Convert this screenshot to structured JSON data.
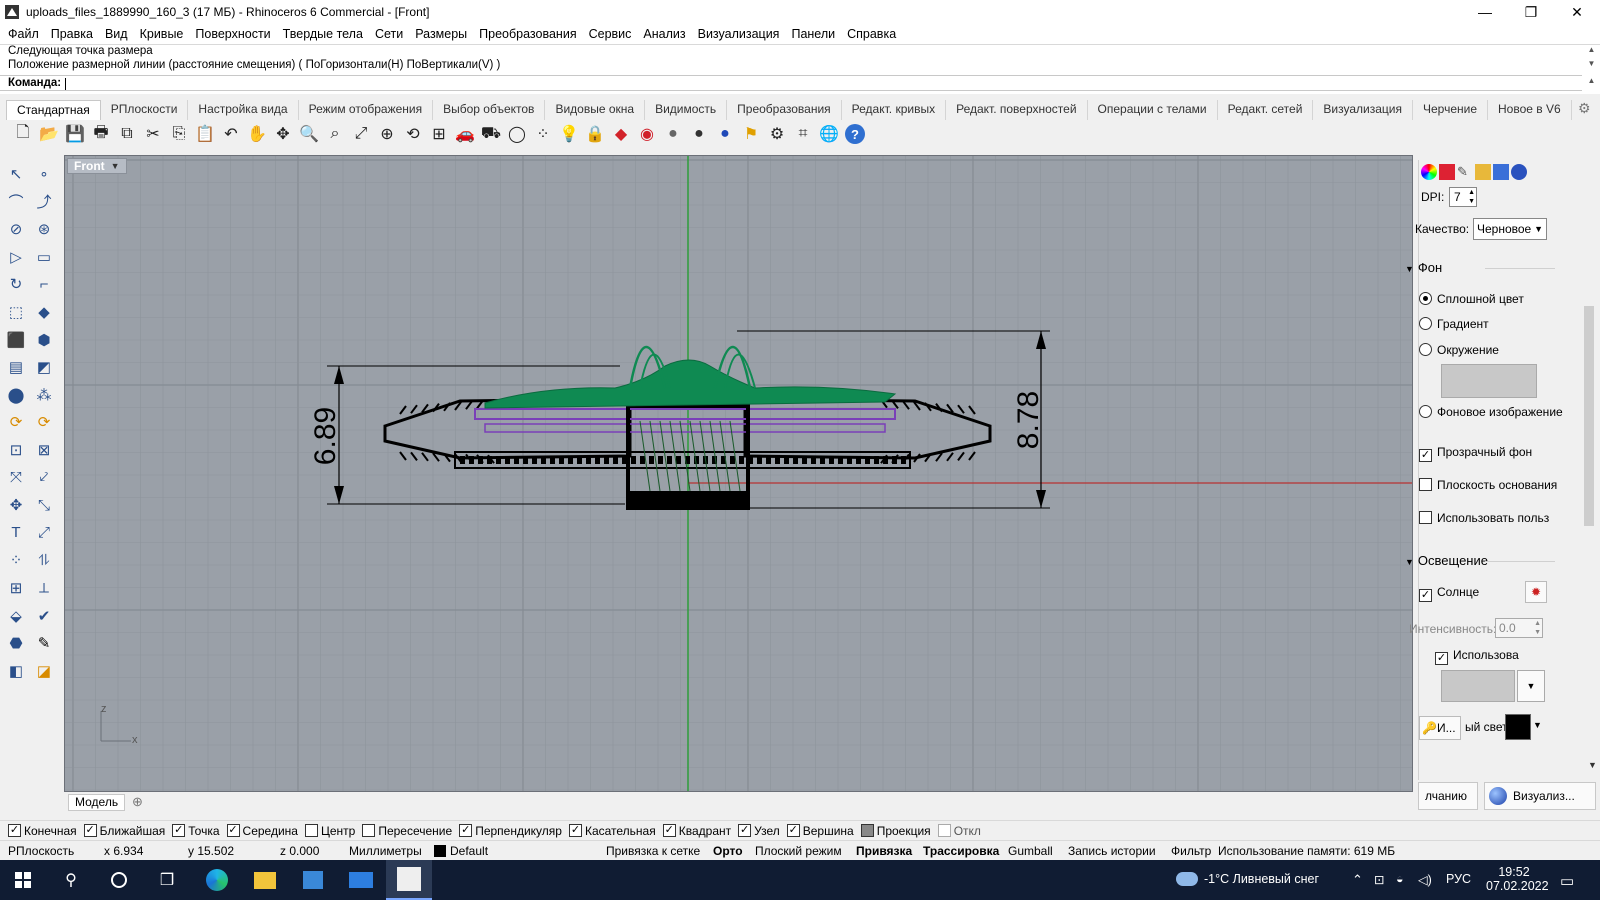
{
  "window": {
    "title": "uploads_files_1889990_160_3 (17 МБ) - Rhinoceros 6 Commercial - [Front]",
    "minimize_glyph": "—",
    "restore_glyph": "❐",
    "close_glyph": "✕"
  },
  "menu": [
    "Файл",
    "Правка",
    "Вид",
    "Кривые",
    "Поверхности",
    "Твердые тела",
    "Сети",
    "Размеры",
    "Преобразования",
    "Сервис",
    "Анализ",
    "Визуализация",
    "Панели",
    "Справка"
  ],
  "command": {
    "history_line1": "Следующая точка размера",
    "history_line2": "Положение размерной линии (расстояние смещения) ( ПоГоризонтали(H)  ПоВертикали(V) )",
    "prompt": "Команда:",
    "value": ""
  },
  "tabs": [
    "Стандартная",
    "РПлоскости",
    "Настройка вида",
    "Режим отображения",
    "Выбор объектов",
    "Видовые окна",
    "Видимость",
    "Преобразования",
    "Редакт. кривых",
    "Редакт. поверхностей",
    "Операции с телами",
    "Редакт. сетей",
    "Визуализация",
    "Черчение",
    "Новое в V6"
  ],
  "active_tab": "Стандартная",
  "toolbar_icons": [
    "new-file-icon",
    "open-icon",
    "save-icon",
    "print-icon",
    "import-icon",
    "cut-icon",
    "copy-icon",
    "paste-icon",
    "undo-icon",
    "pan-icon",
    "rotate-view-icon",
    "zoom-icon",
    "zoom-window-icon",
    "zoom-extents-icon",
    "zoom-selected-icon",
    "rotate-3d-icon",
    "four-viewports-icon",
    "car-icon",
    "shaded-car-icon",
    "circle-icon",
    "points-icon",
    "light-bulb-icon",
    "lock-icon",
    "material-icon",
    "color-wheel-icon",
    "sphere-gray-icon",
    "sphere-dark-icon",
    "sphere-blue-icon",
    "flag-icon",
    "gear-icon",
    "snap-icon",
    "globe-icon",
    "help-icon"
  ],
  "viewport": {
    "name": "Front",
    "dim_left": "6.89",
    "dim_right": "8.78",
    "axis_z": "z",
    "axis_x": "x"
  },
  "model_tab": "Модель",
  "right_panel": {
    "dpi_label": "DPI:",
    "dpi_value": "7",
    "quality_label": "Качество:",
    "quality_value": "Черновое",
    "section_background": "Фон",
    "bg_solid": "Сплошной цвет",
    "bg_gradient": "Градиент",
    "bg_environment": "Окружение",
    "bg_image": "Фоновое изображение",
    "transparent_bg": "Прозрачный фон",
    "ground_plane": "Плоскость основания",
    "use_custom": "Использовать польз",
    "section_lighting": "Освещение",
    "sun": "Солнце",
    "intensity_label": "Интенсивность:",
    "intensity_value": "0.0",
    "use_label": "Использова",
    "ambient_btn": "И...",
    "ambient_label": "ый свет:",
    "btn_default": "лчанию",
    "btn_render": "Визуализ..."
  },
  "osnaps": [
    {
      "label": "Конечная",
      "checked": true
    },
    {
      "label": "Ближайшая",
      "checked": true
    },
    {
      "label": "Точка",
      "checked": true
    },
    {
      "label": "Середина",
      "checked": true
    },
    {
      "label": "Центр",
      "checked": false
    },
    {
      "label": "Пересечение",
      "checked": false
    },
    {
      "label": "Перпендикуляр",
      "checked": true
    },
    {
      "label": "Касательная",
      "checked": true
    },
    {
      "label": "Квадрант",
      "checked": true
    },
    {
      "label": "Узел",
      "checked": true
    },
    {
      "label": "Вершина",
      "checked": true
    },
    {
      "label": "Проекция",
      "checked": false
    },
    {
      "label": "Откл",
      "checked": false
    }
  ],
  "status": {
    "cplane": "РПлоскость",
    "x": "x 6.934",
    "y": "y 15.502",
    "z": "z 0.000",
    "units": "Миллиметры",
    "layer": "Default",
    "grid_snap": "Привязка к сетке",
    "ortho": "Орто",
    "planar": "Плоский режим",
    "osnap": "Привязка",
    "smarttrack": "Трассировка",
    "gumball": "Gumball",
    "history": "Запись истории",
    "filter": "Фильтр",
    "memory": "Использование памяти: 619 МБ"
  },
  "taskbar": {
    "weather": "-1°C  Ливневый снег",
    "lang": "РУС",
    "time": "19:52",
    "date": "07.02.2022"
  },
  "colors": {
    "viewport_bg": "#9aa0a8",
    "grid": "#8e949c",
    "green_axis": "#2e9e3a",
    "red_axis": "#b83232",
    "model_green": "#0f8a52",
    "model_purple": "#7a3fb8",
    "taskbar": "#101c33"
  }
}
